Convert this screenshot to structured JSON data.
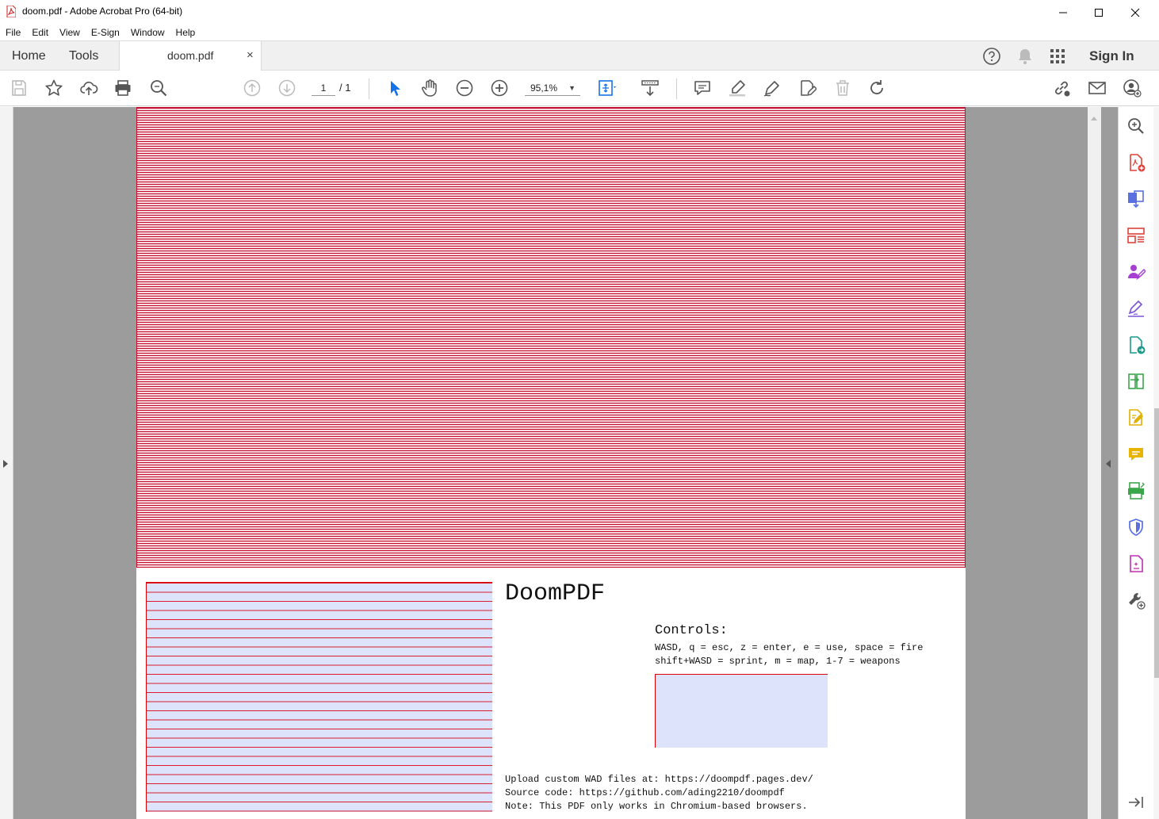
{
  "window": {
    "title": "doom.pdf - Adobe Acrobat Pro (64-bit)",
    "app_icon": "acrobat-pdf-icon",
    "controls": [
      "minimize-icon",
      "maximize-icon",
      "close-icon"
    ]
  },
  "menu": [
    "File",
    "Edit",
    "View",
    "E-Sign",
    "Window",
    "Help"
  ],
  "tabs": {
    "home": "Home",
    "tools": "Tools",
    "document": "doom.pdf",
    "close_glyph": "×"
  },
  "header_right": {
    "sign_in": "Sign In",
    "icons": [
      "help-icon",
      "notifications-bell-icon",
      "apps-grid-icon"
    ]
  },
  "toolbar": {
    "page_current": "1",
    "page_total": "/ 1",
    "zoom": "95,1%",
    "icons": [
      "save-icon",
      "bookmark-star-icon",
      "upload-cloud-icon",
      "print-icon",
      "find-zoom-icon",
      "previous-page-icon",
      "next-page-icon",
      "select-cursor-icon",
      "hand-tool-icon",
      "zoom-out-icon",
      "zoom-in-icon",
      "fit-page-icon",
      "scrolling-mode-icon",
      "comment-icon",
      "highlight-icon",
      "draw-icon",
      "edit-text-icon",
      "delete-icon",
      "undo-icon",
      "share-link-icon",
      "email-icon",
      "add-user-icon"
    ],
    "accent_color": "#1473e6"
  },
  "document": {
    "title": "DoomPDF",
    "controls_heading": "Controls:",
    "controls_lines": [
      "WASD, q = esc, z = enter, e = use, space = fire",
      "shift+WASD = sprint, m = map, 1-7 = weapons"
    ],
    "footer_lines": [
      "Upload custom WAD files at: https://doompdf.pages.dev/",
      "Source code: https://github.com/ading2210/doompdf",
      "Note: This PDF only works in Chromium-based browsers."
    ],
    "screen_color": "#c40c2c",
    "panel_color": "#dde3fb"
  },
  "right_panel": {
    "icons": [
      "search-zoom-icon",
      "create-pdf-icon",
      "combine-files-icon",
      "organize-pages-icon",
      "request-signature-icon",
      "fill-sign-icon",
      "export-pdf-icon",
      "compare-files-icon",
      "edit-pdf-icon",
      "comment-icon",
      "scan-ocr-icon",
      "protect-shield-icon",
      "prepare-form-icon",
      "more-tools-icon",
      "collapse-panel-icon"
    ]
  }
}
